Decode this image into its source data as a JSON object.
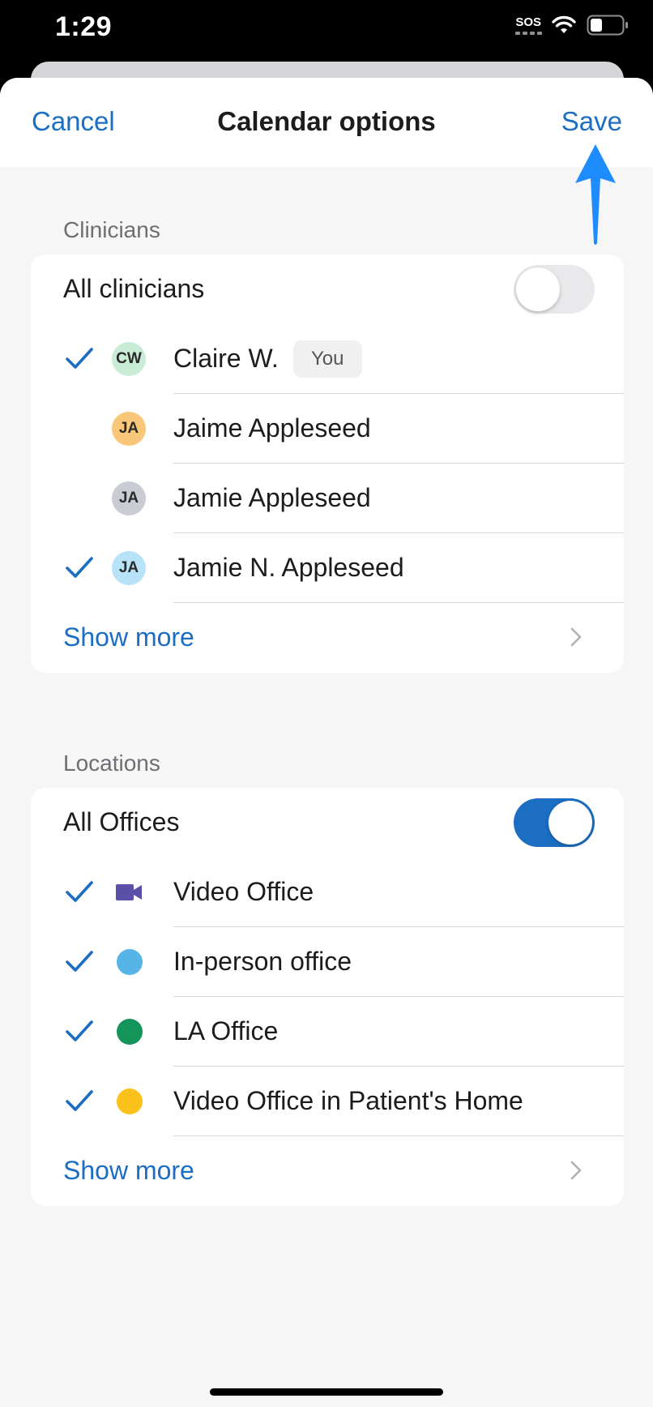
{
  "status": {
    "time": "1:29",
    "sos": "SOS"
  },
  "nav": {
    "cancel": "Cancel",
    "title": "Calendar options",
    "save": "Save"
  },
  "clinicians": {
    "section_label": "Clinicians",
    "all_label": "All clinicians",
    "all_toggle": "off",
    "items": [
      {
        "initials": "CW",
        "name": "Claire W.",
        "checked": true,
        "avatar_color": "#c8ecd6",
        "badge": "You"
      },
      {
        "initials": "JA",
        "name": "Jaime Appleseed",
        "checked": false,
        "avatar_color": "#f8c77a"
      },
      {
        "initials": "JA",
        "name": "Jamie Appleseed",
        "checked": false,
        "avatar_color": "#c9ccd3"
      },
      {
        "initials": "JA",
        "name": "Jamie N. Appleseed",
        "checked": true,
        "avatar_color": "#b7e2f7"
      }
    ],
    "show_more": "Show more"
  },
  "locations": {
    "section_label": "Locations",
    "all_label": "All Offices",
    "all_toggle": "on",
    "items": [
      {
        "name": "Video Office",
        "checked": true,
        "icon": "video-camera-icon",
        "color": "#5b4fa8"
      },
      {
        "name": "In-person office",
        "checked": true,
        "icon": "dot-icon",
        "color": "#56b4e6"
      },
      {
        "name": "LA Office",
        "checked": true,
        "icon": "dot-icon",
        "color": "#16955a"
      },
      {
        "name": "Video Office in Patient's Home",
        "checked": true,
        "icon": "dot-icon",
        "color": "#fbc21c"
      }
    ],
    "show_more": "Show more"
  },
  "colors": {
    "accent": "#1b6ec2",
    "annotation_arrow": "#1e8cff"
  }
}
